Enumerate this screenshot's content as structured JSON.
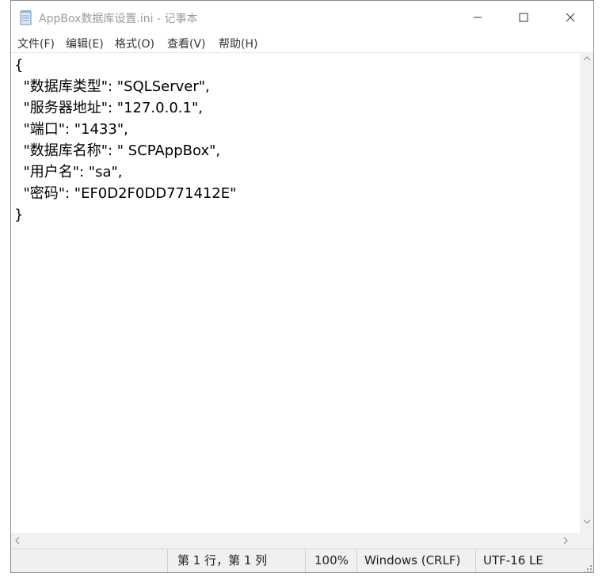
{
  "window": {
    "title": "AppBox数据库设置.ini - 记事本",
    "controls": {
      "minimize_icon": "minimize-icon",
      "maximize_icon": "maximize-icon",
      "close_icon": "close-icon"
    }
  },
  "menu": {
    "file": "文件(F)",
    "edit": "编辑(E)",
    "format": "格式(O)",
    "view": "查看(V)",
    "help": "帮助(H)"
  },
  "document": {
    "content": "{\n  \"数据库类型\": \"SQLServer\",\n  \"服务器地址\": \"127.0.0.1\",\n  \"端口\": \"1433\",\n  \"数据库名称\": \" SCPAppBox\",\n  \"用户名\": \"sa\",\n  \"密码\": \"EF0D2F0DD771412E\"\n}"
  },
  "statusbar": {
    "position": "第 1 行，第 1 列",
    "zoom": "100%",
    "line_ending": "Windows (CRLF)",
    "encoding": "UTF-16 LE"
  },
  "colors": {
    "title_text": "#9a9a9a",
    "statusbar_bg": "#f0f0f0",
    "scrollbar_bg": "#f1f1f1"
  }
}
